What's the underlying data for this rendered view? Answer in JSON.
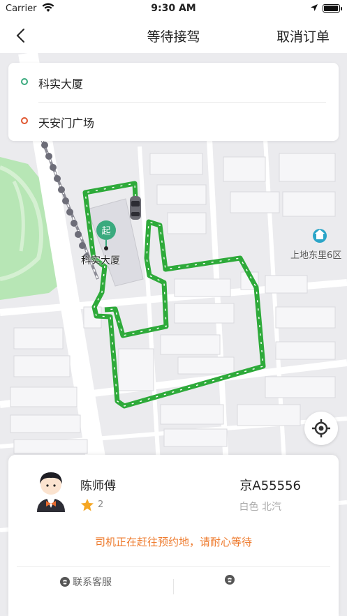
{
  "status_bar": {
    "carrier": "Carrier",
    "time": "9:30 AM",
    "battery_level": 1.0
  },
  "nav": {
    "title": "等待接驾",
    "cancel_label": "取消订单"
  },
  "trip": {
    "start": "科实大厦",
    "end": "天安门广场",
    "start_dot_color": "#3aaa7e",
    "end_dot_color": "#e0562f"
  },
  "map": {
    "start_marker_label": "起",
    "start_place_label": "科实大厦",
    "poi_label": "上地东里6区",
    "route_color": "#2eaa3a",
    "park_color": "#b7e6b5"
  },
  "driver": {
    "name": "陈师傅",
    "rating": "2",
    "plate": "京A55556",
    "car_color": "白色",
    "car_brand": "北汽",
    "status_message": "司机正在赶往预约地，请耐心等待",
    "star_color": "#f5a623",
    "message_color": "#ee7a2c"
  },
  "actions": {
    "contact_service": "联系客服"
  },
  "icons": {
    "back": "chevron-left-icon",
    "locate": "crosshair-icon",
    "phone": "phone-icon",
    "car": "car-icon",
    "star": "star-icon",
    "poi": "building-icon"
  }
}
